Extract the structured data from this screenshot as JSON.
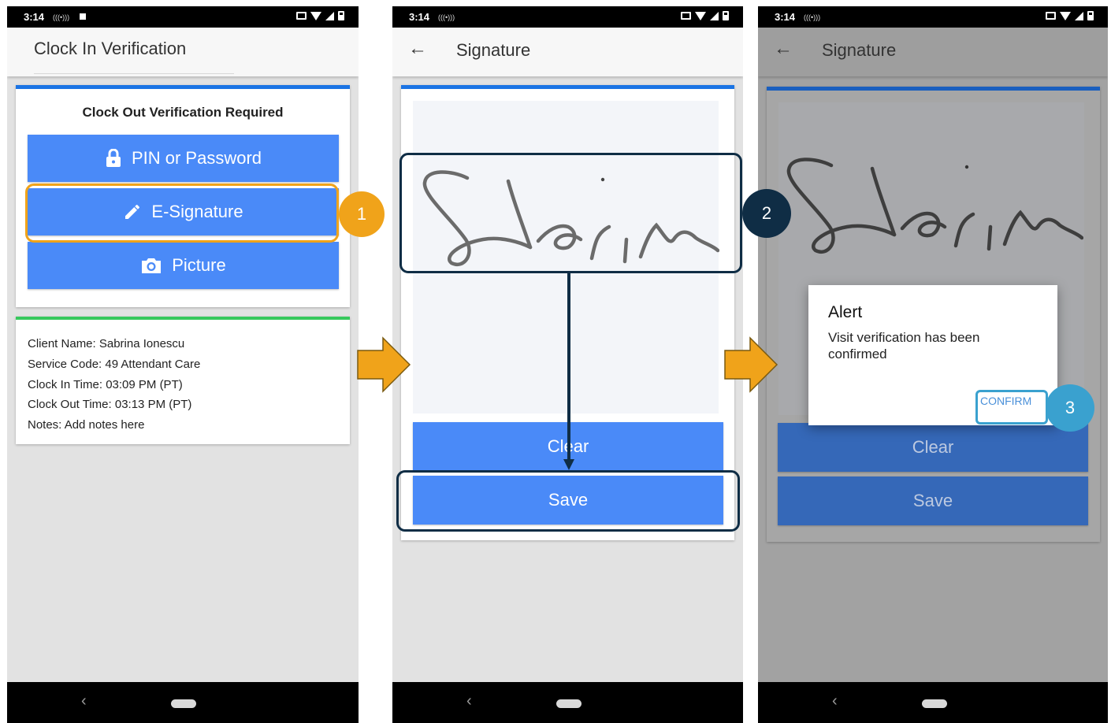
{
  "status_time": "3:14",
  "status_icons": "(((•)))",
  "screen1": {
    "app_title": "Clock In Verification",
    "card_title": "Clock Out Verification Required",
    "buttons": [
      {
        "label": "PIN or Password",
        "icon": "lock-icon"
      },
      {
        "label": "E-Signature",
        "icon": "pencil-icon"
      },
      {
        "label": "Picture",
        "icon": "camera-icon"
      }
    ],
    "info": {
      "client_name": "Client Name: Sabrina Ionescu",
      "service_code": "Service Code: 49 Attendant Care",
      "clock_in": "Clock In Time: 03:09 PM (PT)",
      "clock_out": "Clock Out Time: 03:13 PM (PT)",
      "notes": "Notes: Add notes here"
    }
  },
  "screen2": {
    "app_title": "Signature",
    "back_icon": "arrow-left-icon",
    "clear_label": "Clear",
    "save_label": "Save"
  },
  "screen3": {
    "app_title": "Signature",
    "alert_title": "Alert",
    "alert_message": "Visit verification has been confirmed",
    "confirm_label": "CONFIRM",
    "clear_label": "Clear",
    "save_label": "Save"
  },
  "callouts": [
    "1",
    "2",
    "3"
  ],
  "colors": {
    "button_blue": "#4a8af8",
    "accent_blue": "#1b74e4",
    "accent_green": "#37c95d",
    "callout_orange": "#f0a31a",
    "callout_navy": "#0f2d45",
    "callout_teal": "#3aa1cf",
    "step_arrow": "#f0a31a"
  }
}
